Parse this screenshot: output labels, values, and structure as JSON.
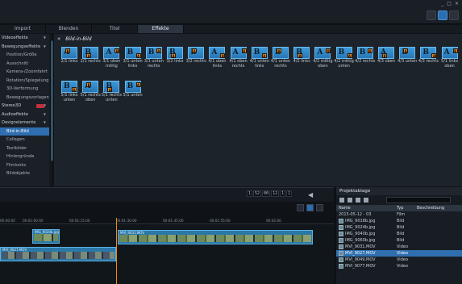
{
  "window": {
    "buttons": [
      "_",
      "□",
      "×"
    ]
  },
  "tabs": [
    {
      "label": "Import",
      "active": false
    },
    {
      "label": "Blenden",
      "active": false
    },
    {
      "label": "Titel",
      "active": false
    },
    {
      "label": "Effekte",
      "active": true
    }
  ],
  "sidebar": {
    "items": [
      {
        "label": "Videoeffekte",
        "sub": false
      },
      {
        "label": "Bewegungseffekte",
        "sub": false
      },
      {
        "label": "Position/Größe",
        "sub": true
      },
      {
        "label": "Ausschnitt",
        "sub": true
      },
      {
        "label": "Kamera-/Zoomfahrt",
        "sub": true
      },
      {
        "label": "Rotation/Spiegelung",
        "sub": true
      },
      {
        "label": "3D-Verformung",
        "sub": true
      },
      {
        "label": "Bewegungsvorlagen",
        "sub": true
      },
      {
        "label": "Stereo3D",
        "sub": false
      },
      {
        "label": "Audioeffekte",
        "sub": false
      },
      {
        "label": "Designelemente",
        "sub": false
      },
      {
        "label": "Bild-in-Bild",
        "sub": true,
        "selected": true
      },
      {
        "label": "Collagen",
        "sub": true
      },
      {
        "label": "Textbilder",
        "sub": true
      },
      {
        "label": "Hintergründe",
        "sub": true
      },
      {
        "label": "Filmlooks",
        "sub": true
      },
      {
        "label": "Bildobjekte",
        "sub": true
      }
    ]
  },
  "effects": {
    "title": "Bild-in-Bild",
    "back_icon": "double-chevron-left-icon",
    "accent": "#e08a2c",
    "tiles": [
      {
        "label": "2/1 links",
        "big": "A",
        "small": "B"
      },
      {
        "label": "2/1 rechts",
        "big": "B",
        "small": "A"
      },
      {
        "label": "3/1 oben mittig",
        "big": "A",
        "small": "B"
      },
      {
        "label": "3/1 unten links",
        "big": "B",
        "small": "A"
      },
      {
        "label": "3/1 unten rechts",
        "big": "B",
        "small": "A"
      },
      {
        "label": "3/2 links",
        "big": "B",
        "small": "A"
      },
      {
        "label": "3/2 rechts",
        "big": "B",
        "small": "A"
      },
      {
        "label": "4/1 oben links",
        "big": "A",
        "small": "B"
      },
      {
        "label": "4/1 oben rechts",
        "big": "A",
        "small": "B"
      },
      {
        "label": "4/1 unten links",
        "big": "B",
        "small": "A"
      },
      {
        "label": "4/1 unten rechts",
        "big": "B",
        "small": "A"
      },
      {
        "label": "4/2 links",
        "big": "B",
        "small": "A"
      },
      {
        "label": "4/2 mittig oben",
        "big": "A",
        "small": "B"
      },
      {
        "label": "4/2 mittig unten",
        "big": "B",
        "small": "A"
      },
      {
        "label": "4/2 rechts",
        "big": "B",
        "small": "A"
      },
      {
        "label": "4/3 oben",
        "big": "A",
        "small": "B"
      },
      {
        "label": "4/3 unten",
        "big": "B",
        "small": "A"
      },
      {
        "label": "4/3 rechts",
        "big": "B",
        "small": "A"
      },
      {
        "label": "5/1 links oben",
        "big": "A",
        "small": "B"
      },
      {
        "label": "5/1 links unten",
        "big": "B",
        "small": "A"
      },
      {
        "label": "5/1 rechts oben",
        "big": "A",
        "small": "B"
      },
      {
        "label": "5/1 rechts unten",
        "big": "B",
        "small": "A"
      },
      {
        "label": "5/1 unten",
        "big": "B",
        "small": "A"
      }
    ]
  },
  "timeline": {
    "timecode": [
      "1",
      "52",
      "00",
      "12",
      "1",
      "1"
    ],
    "ticks": [
      "00:00:00",
      "00:01:00:00",
      "00:01:15:00",
      "00:01:30:00",
      "00:01:45:00",
      "00:01:55:00",
      "00:02:00"
    ],
    "clips": [
      {
        "label": "IMG_9020b.jpg",
        "dark": false
      },
      {
        "label": "MVI_9031.MOV",
        "dark": false
      },
      {
        "label": "MVI_9027.MOV",
        "dark": true
      }
    ]
  },
  "project": {
    "title": "Projektablage",
    "columns": [
      "Name",
      "Typ",
      "Beschreibung"
    ],
    "rows": [
      {
        "name": "2015-05-12 - 03",
        "type": "Film"
      },
      {
        "name": "IMG_9018b.jpg",
        "type": "Bild"
      },
      {
        "name": "IMG_9024b.jpg",
        "type": "Bild"
      },
      {
        "name": "IMG_9040b.jpg",
        "type": "Bild"
      },
      {
        "name": "IMG_9060b.jpg",
        "type": "Bild"
      },
      {
        "name": "MVI_9031.MOV",
        "type": "Video"
      },
      {
        "name": "MVI_9027.MOV",
        "type": "Video",
        "selected": true
      },
      {
        "name": "MVI_9049.MOV",
        "type": "Video"
      },
      {
        "name": "MVI_9077.MOV",
        "type": "Video"
      }
    ]
  }
}
